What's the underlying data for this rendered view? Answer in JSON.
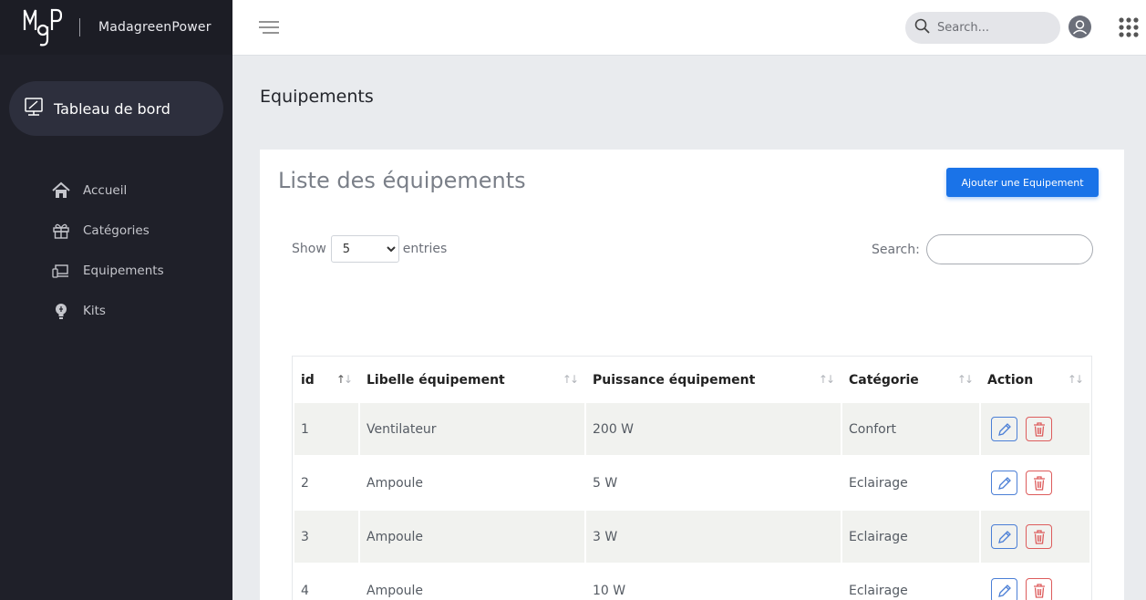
{
  "brand": {
    "name": "MadagreenPower"
  },
  "sidebar": {
    "dashboard_label": "Tableau de bord",
    "items": [
      {
        "label": "Accueil",
        "icon": "home-icon"
      },
      {
        "label": "Catégories",
        "icon": "gift-icon"
      },
      {
        "label": "Equipements",
        "icon": "devices-icon"
      },
      {
        "label": "Kits",
        "icon": "lightbulb-icon"
      }
    ]
  },
  "topbar": {
    "search_placeholder": "Search..."
  },
  "page": {
    "title": "Equipements"
  },
  "card": {
    "title": "Liste des équipements",
    "add_button": "Ajouter une Equipement",
    "show_label": "Show",
    "entries_label": "entries",
    "page_size": "5",
    "search_label": "Search:"
  },
  "table": {
    "columns": [
      "id",
      "Libelle équipement",
      "Puissance équipement",
      "Catégorie",
      "Action"
    ],
    "rows": [
      {
        "id": "1",
        "libelle": "Ventilateur",
        "puissance": "200 W",
        "categorie": "Confort"
      },
      {
        "id": "2",
        "libelle": "Ampoule",
        "puissance": "5 W",
        "categorie": "Eclairage"
      },
      {
        "id": "3",
        "libelle": "Ampoule",
        "puissance": "3 W",
        "categorie": "Eclairage"
      },
      {
        "id": "4",
        "libelle": "Ampoule",
        "puissance": "10 W",
        "categorie": "Eclairage"
      }
    ]
  },
  "colors": {
    "sidebar_bg": "#1f2029",
    "accent": "#1a73e8",
    "edit": "#4b7fd6",
    "delete": "#dd5c5c"
  }
}
